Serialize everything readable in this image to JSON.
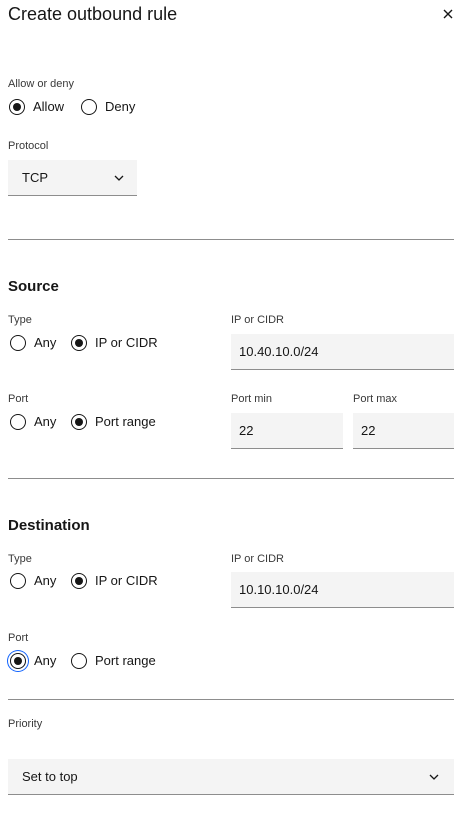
{
  "title": "Create outbound rule",
  "allow_deny": {
    "label": "Allow or deny",
    "options": [
      "Allow",
      "Deny"
    ],
    "selected": "Allow"
  },
  "protocol": {
    "label": "Protocol",
    "value": "TCP"
  },
  "source": {
    "heading": "Source",
    "type_label": "Type",
    "type_options": [
      "Any",
      "IP or CIDR"
    ],
    "type_selected": "IP or CIDR",
    "ip_label": "IP or CIDR",
    "ip_value": "10.40.10.0/24",
    "port_label": "Port",
    "port_options": [
      "Any",
      "Port range"
    ],
    "port_selected": "Port range",
    "port_min_label": "Port min",
    "port_min_value": "22",
    "port_max_label": "Port max",
    "port_max_value": "22"
  },
  "destination": {
    "heading": "Destination",
    "type_label": "Type",
    "type_options": [
      "Any",
      "IP or CIDR"
    ],
    "type_selected": "IP or CIDR",
    "ip_label": "IP or CIDR",
    "ip_value": "10.10.10.0/24",
    "port_label": "Port",
    "port_options": [
      "Any",
      "Port range"
    ],
    "port_selected": "Any"
  },
  "priority": {
    "label": "Priority",
    "value": "Set to top"
  },
  "colors": {
    "focus": "#0f62fe",
    "field_bg": "#f4f4f4",
    "text": "#161616"
  }
}
